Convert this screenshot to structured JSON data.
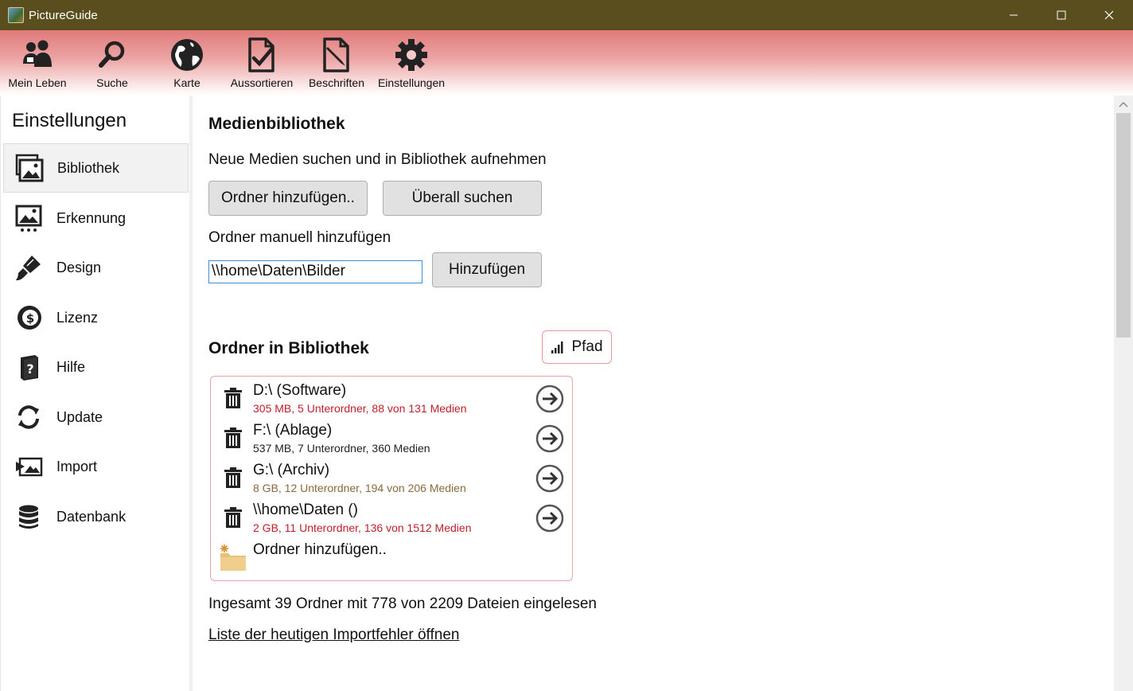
{
  "window": {
    "title": "PictureGuide"
  },
  "colors": {
    "titlebar": "#5b4e1e",
    "toolbar_accent": "#e07a7a",
    "error_text": "#c0202a",
    "warn_text": "#8a6a3a",
    "ok_text": "#222222",
    "focus": "#3b8ed6"
  },
  "toolbar": {
    "items": [
      {
        "label": "Mein Leben",
        "icon": "people-icon"
      },
      {
        "label": "Suche",
        "icon": "search-icon"
      },
      {
        "label": "Karte",
        "icon": "globe-icon"
      },
      {
        "label": "Aussortieren",
        "icon": "document-check-icon"
      },
      {
        "label": "Beschriften",
        "icon": "document-edit-icon"
      },
      {
        "label": "Einstellungen",
        "icon": "gear-icon"
      }
    ]
  },
  "sidebar": {
    "heading": "Einstellungen",
    "items": [
      {
        "label": "Bibliothek",
        "icon": "library-images-icon",
        "active": true
      },
      {
        "label": "Erkennung",
        "icon": "image-detect-icon"
      },
      {
        "label": "Design",
        "icon": "brush-icon"
      },
      {
        "label": "Lizenz",
        "icon": "dollar-coin-icon"
      },
      {
        "label": "Hilfe",
        "icon": "help-book-icon"
      },
      {
        "label": "Update",
        "icon": "refresh-icon"
      },
      {
        "label": "Import",
        "icon": "import-image-icon"
      },
      {
        "label": "Datenbank",
        "icon": "database-icon"
      }
    ]
  },
  "main": {
    "title": "Medienbibliothek",
    "scan_label": "Neue Medien suchen und in Bibliothek aufnehmen",
    "add_folder_button": "Ordner hinzufügen..",
    "search_everywhere_button": "Überall suchen",
    "manual_label": "Ordner manuell hinzufügen",
    "manual_input_value": "\\\\home\\Daten\\Bilder",
    "add_button": "Hinzufügen",
    "folders_title": "Ordner in Bibliothek",
    "sort_button": "Pfad",
    "folders": [
      {
        "name": "D:\\ (Software)",
        "info": "305 MB, 5 Unterordner, 88 von 131 Medien",
        "status": "error"
      },
      {
        "name": "F:\\ (Ablage)",
        "info": "537 MB, 7 Unterordner, 360 Medien",
        "status": "ok"
      },
      {
        "name": "G:\\ (Archiv)",
        "info": "8 GB, 12 Unterordner, 194 von 206 Medien",
        "status": "warn"
      },
      {
        "name": "\\\\home\\Daten ()",
        "info": "2 GB, 11 Unterordner, 136 von 1512 Medien",
        "status": "error"
      }
    ],
    "add_folder_row": "Ordner hinzufügen..",
    "summary": "Ingesamt  39 Ordner mit 778 von 2209 Dateien eingelesen",
    "error_link": "Liste der heutigen Importfehler öffnen"
  }
}
